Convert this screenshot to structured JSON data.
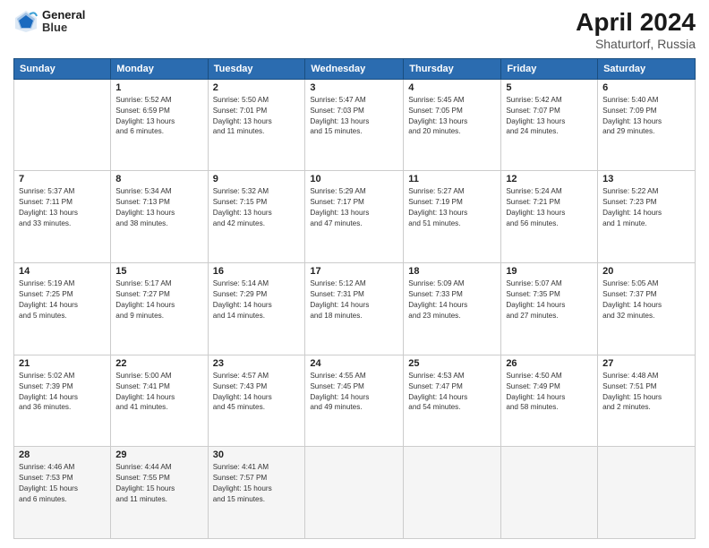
{
  "header": {
    "logo_line1": "General",
    "logo_line2": "Blue",
    "month_year": "April 2024",
    "location": "Shaturtorf, Russia"
  },
  "days_of_week": [
    "Sunday",
    "Monday",
    "Tuesday",
    "Wednesday",
    "Thursday",
    "Friday",
    "Saturday"
  ],
  "weeks": [
    [
      {
        "day": "",
        "info": ""
      },
      {
        "day": "1",
        "info": "Sunrise: 5:52 AM\nSunset: 6:59 PM\nDaylight: 13 hours\nand 6 minutes."
      },
      {
        "day": "2",
        "info": "Sunrise: 5:50 AM\nSunset: 7:01 PM\nDaylight: 13 hours\nand 11 minutes."
      },
      {
        "day": "3",
        "info": "Sunrise: 5:47 AM\nSunset: 7:03 PM\nDaylight: 13 hours\nand 15 minutes."
      },
      {
        "day": "4",
        "info": "Sunrise: 5:45 AM\nSunset: 7:05 PM\nDaylight: 13 hours\nand 20 minutes."
      },
      {
        "day": "5",
        "info": "Sunrise: 5:42 AM\nSunset: 7:07 PM\nDaylight: 13 hours\nand 24 minutes."
      },
      {
        "day": "6",
        "info": "Sunrise: 5:40 AM\nSunset: 7:09 PM\nDaylight: 13 hours\nand 29 minutes."
      }
    ],
    [
      {
        "day": "7",
        "info": "Sunrise: 5:37 AM\nSunset: 7:11 PM\nDaylight: 13 hours\nand 33 minutes."
      },
      {
        "day": "8",
        "info": "Sunrise: 5:34 AM\nSunset: 7:13 PM\nDaylight: 13 hours\nand 38 minutes."
      },
      {
        "day": "9",
        "info": "Sunrise: 5:32 AM\nSunset: 7:15 PM\nDaylight: 13 hours\nand 42 minutes."
      },
      {
        "day": "10",
        "info": "Sunrise: 5:29 AM\nSunset: 7:17 PM\nDaylight: 13 hours\nand 47 minutes."
      },
      {
        "day": "11",
        "info": "Sunrise: 5:27 AM\nSunset: 7:19 PM\nDaylight: 13 hours\nand 51 minutes."
      },
      {
        "day": "12",
        "info": "Sunrise: 5:24 AM\nSunset: 7:21 PM\nDaylight: 13 hours\nand 56 minutes."
      },
      {
        "day": "13",
        "info": "Sunrise: 5:22 AM\nSunset: 7:23 PM\nDaylight: 14 hours\nand 1 minute."
      }
    ],
    [
      {
        "day": "14",
        "info": "Sunrise: 5:19 AM\nSunset: 7:25 PM\nDaylight: 14 hours\nand 5 minutes."
      },
      {
        "day": "15",
        "info": "Sunrise: 5:17 AM\nSunset: 7:27 PM\nDaylight: 14 hours\nand 9 minutes."
      },
      {
        "day": "16",
        "info": "Sunrise: 5:14 AM\nSunset: 7:29 PM\nDaylight: 14 hours\nand 14 minutes."
      },
      {
        "day": "17",
        "info": "Sunrise: 5:12 AM\nSunset: 7:31 PM\nDaylight: 14 hours\nand 18 minutes."
      },
      {
        "day": "18",
        "info": "Sunrise: 5:09 AM\nSunset: 7:33 PM\nDaylight: 14 hours\nand 23 minutes."
      },
      {
        "day": "19",
        "info": "Sunrise: 5:07 AM\nSunset: 7:35 PM\nDaylight: 14 hours\nand 27 minutes."
      },
      {
        "day": "20",
        "info": "Sunrise: 5:05 AM\nSunset: 7:37 PM\nDaylight: 14 hours\nand 32 minutes."
      }
    ],
    [
      {
        "day": "21",
        "info": "Sunrise: 5:02 AM\nSunset: 7:39 PM\nDaylight: 14 hours\nand 36 minutes."
      },
      {
        "day": "22",
        "info": "Sunrise: 5:00 AM\nSunset: 7:41 PM\nDaylight: 14 hours\nand 41 minutes."
      },
      {
        "day": "23",
        "info": "Sunrise: 4:57 AM\nSunset: 7:43 PM\nDaylight: 14 hours\nand 45 minutes."
      },
      {
        "day": "24",
        "info": "Sunrise: 4:55 AM\nSunset: 7:45 PM\nDaylight: 14 hours\nand 49 minutes."
      },
      {
        "day": "25",
        "info": "Sunrise: 4:53 AM\nSunset: 7:47 PM\nDaylight: 14 hours\nand 54 minutes."
      },
      {
        "day": "26",
        "info": "Sunrise: 4:50 AM\nSunset: 7:49 PM\nDaylight: 14 hours\nand 58 minutes."
      },
      {
        "day": "27",
        "info": "Sunrise: 4:48 AM\nSunset: 7:51 PM\nDaylight: 15 hours\nand 2 minutes."
      }
    ],
    [
      {
        "day": "28",
        "info": "Sunrise: 4:46 AM\nSunset: 7:53 PM\nDaylight: 15 hours\nand 6 minutes."
      },
      {
        "day": "29",
        "info": "Sunrise: 4:44 AM\nSunset: 7:55 PM\nDaylight: 15 hours\nand 11 minutes."
      },
      {
        "day": "30",
        "info": "Sunrise: 4:41 AM\nSunset: 7:57 PM\nDaylight: 15 hours\nand 15 minutes."
      },
      {
        "day": "",
        "info": ""
      },
      {
        "day": "",
        "info": ""
      },
      {
        "day": "",
        "info": ""
      },
      {
        "day": "",
        "info": ""
      }
    ]
  ]
}
